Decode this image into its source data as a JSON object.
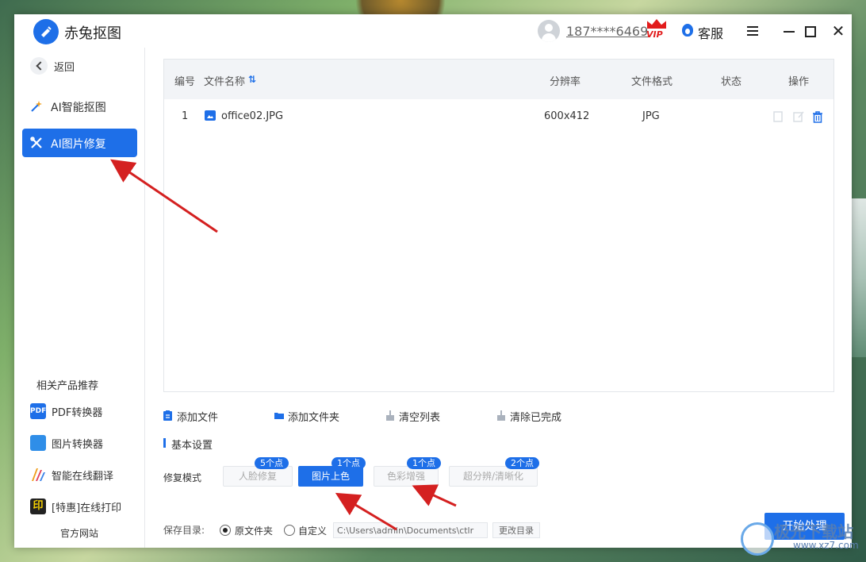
{
  "app": {
    "title": "赤兔抠图",
    "user_phone": "187****6469",
    "vip_badge": "VIP",
    "customer_service": "客服"
  },
  "sidebar": {
    "back": "返回",
    "items": [
      {
        "label": "AI智能抠图",
        "icon": "magic-wand-icon",
        "active": false
      },
      {
        "label": "AI图片修复",
        "icon": "tools-icon",
        "active": true
      }
    ],
    "recommend_title": "相关产品推荐",
    "products": [
      {
        "label": "PDF转换器",
        "icon": "pdf-icon",
        "icon_text": "PDF"
      },
      {
        "label": "图片转换器",
        "icon": "image-converter-icon"
      },
      {
        "label": "智能在线翻译",
        "icon": "translate-icon"
      },
      {
        "label": "[特惠]在线打印",
        "icon": "print-icon",
        "icon_text": "印"
      }
    ],
    "official_site": "官方网站"
  },
  "table": {
    "headers": {
      "no": "编号",
      "name": "文件名称",
      "resolution": "分辨率",
      "format": "文件格式",
      "status": "状态",
      "action": "操作"
    },
    "rows": [
      {
        "no": "1",
        "name": "office02.JPG",
        "resolution": "600x412",
        "format": "JPG",
        "status": ""
      }
    ]
  },
  "toolbar": {
    "add_file": "添加文件",
    "add_folder": "添加文件夹",
    "clear_list": "清空列表",
    "clear_done": "清除已完成"
  },
  "settings": {
    "title": "基本设置",
    "mode_label": "修复模式",
    "modes": [
      {
        "label": "人脸修复",
        "badge": "5个点",
        "active": false
      },
      {
        "label": "图片上色",
        "badge": "1个点",
        "active": true
      },
      {
        "label": "色彩增强",
        "badge": "1个点",
        "active": false
      },
      {
        "label": "超分辨/清晰化",
        "badge": "2个点",
        "active": false
      }
    ],
    "save_dir_label": "保存目录:",
    "radio_original": "原文件夹",
    "radio_custom": "自定义",
    "save_path": "C:\\Users\\admin\\Documents\\ctlr",
    "change_dir": "更改目录"
  },
  "start_button": "开始处理",
  "watermark": {
    "text": "极光下载站",
    "url": "www.xz7.com"
  },
  "colors": {
    "accent": "#1e6fe8",
    "vip_red": "#e21c1c",
    "annotation_arrow": "#d42020"
  }
}
